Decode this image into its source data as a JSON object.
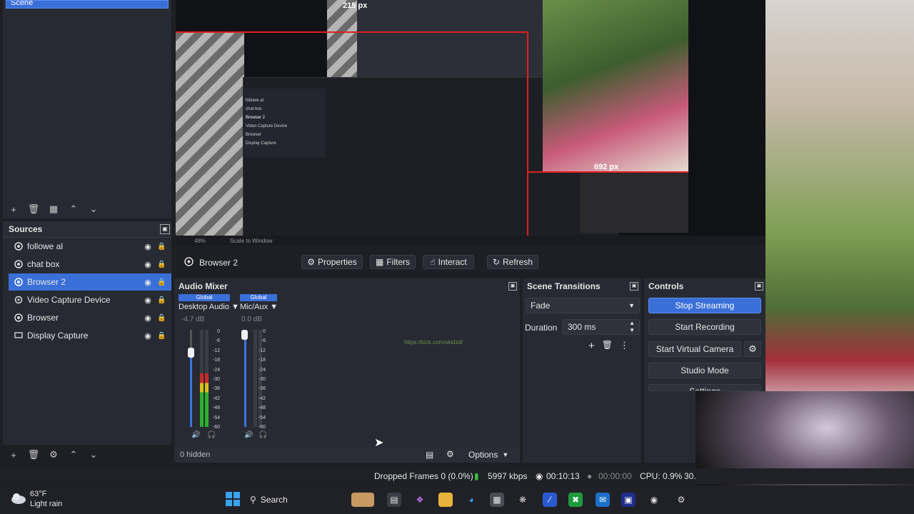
{
  "scenes": {
    "selected_scene": "Scene",
    "toolbar": [
      "add-icon",
      "remove-icon",
      "filter-icon",
      "up-icon",
      "down-icon"
    ]
  },
  "sources": {
    "title": "Sources",
    "items": [
      {
        "label": "followe al",
        "icon": "browser-icon",
        "selected": false
      },
      {
        "label": "chat box",
        "icon": "browser-icon",
        "selected": false
      },
      {
        "label": "Browser 2",
        "icon": "browser-icon",
        "selected": true
      },
      {
        "label": "Video Capture Device",
        "icon": "camera-icon",
        "selected": false
      },
      {
        "label": "Browser",
        "icon": "browser-icon",
        "selected": false
      },
      {
        "label": "Display Capture",
        "icon": "monitor-icon",
        "selected": false
      }
    ]
  },
  "preview": {
    "measure_top": "215 px",
    "measure_right": "692 px",
    "zoom": "48%",
    "scale_mode": "Scale to Window",
    "inner_sources": [
      "followe al",
      "chat box",
      "Browser 2",
      "Video Capture Device",
      "Browser",
      "Display Capture"
    ]
  },
  "source_bar": {
    "name": "Browser 2",
    "properties": "Properties",
    "filters": "Filters",
    "interact": "Interact",
    "refresh": "Refresh"
  },
  "mixer": {
    "title": "Audio Mixer",
    "channels": [
      {
        "tag": "Global",
        "name": "Desktop Audio",
        "db": "-4.7 dB",
        "level": 0.55
      },
      {
        "tag": "Global",
        "name": "Mic/Aux",
        "db": "0.0 dB",
        "level": 0.0
      }
    ],
    "ticks": [
      "0",
      "-6",
      "-12",
      "-18",
      "-24",
      "-30",
      "-36",
      "-42",
      "-48",
      "-54",
      "-60"
    ],
    "hidden": "0 hidden",
    "options": "Options",
    "watermark": "https://kick.com/skidzd/"
  },
  "transitions": {
    "title": "Scene Transitions",
    "selected": "Fade",
    "duration_label": "Duration",
    "duration_value": "300 ms"
  },
  "controls": {
    "title": "Controls",
    "stop_streaming": "Stop Streaming",
    "start_recording": "Start Recording",
    "start_virtual_camera": "Start Virtual Camera",
    "studio_mode": "Studio Mode",
    "settings": "Settings"
  },
  "status": {
    "dropped": "Dropped Frames 0 (0.0%)",
    "bitrate": "5997 kbps",
    "stream_time": "00:10:13",
    "rec_time": "00:00:00",
    "cpu": "CPU: 0.9%",
    "fps": "30."
  },
  "taskbar": {
    "temp": "63°F",
    "weather": "Light rain",
    "search": "Search"
  },
  "colors": {
    "accent": "#3a6fd8",
    "panel": "#272a33",
    "background": "#1e1f24"
  }
}
